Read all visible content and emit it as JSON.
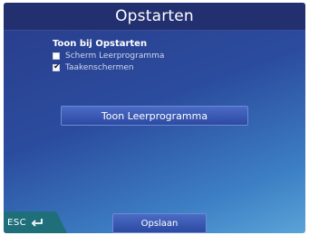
{
  "window": {
    "title": "Opstarten"
  },
  "section": {
    "heading": "Toon bij Opstarten",
    "options": [
      {
        "label": "Scherm Leerprogramma",
        "checked": false
      },
      {
        "label": "Taakenschermen",
        "checked": true
      }
    ]
  },
  "actions": {
    "show_tutorial_label": "Toon Leerprogramma",
    "save_label": "Opslaan"
  },
  "footer": {
    "esc_label": "ESC",
    "esc_icon": "return-arrow-icon"
  },
  "colors": {
    "background_top": "#2a3c8a",
    "background_bottom": "#5aa3d8",
    "title_bar": "#233070",
    "esc_tab": "#1f6f7a",
    "button": "#2d4aa2"
  }
}
